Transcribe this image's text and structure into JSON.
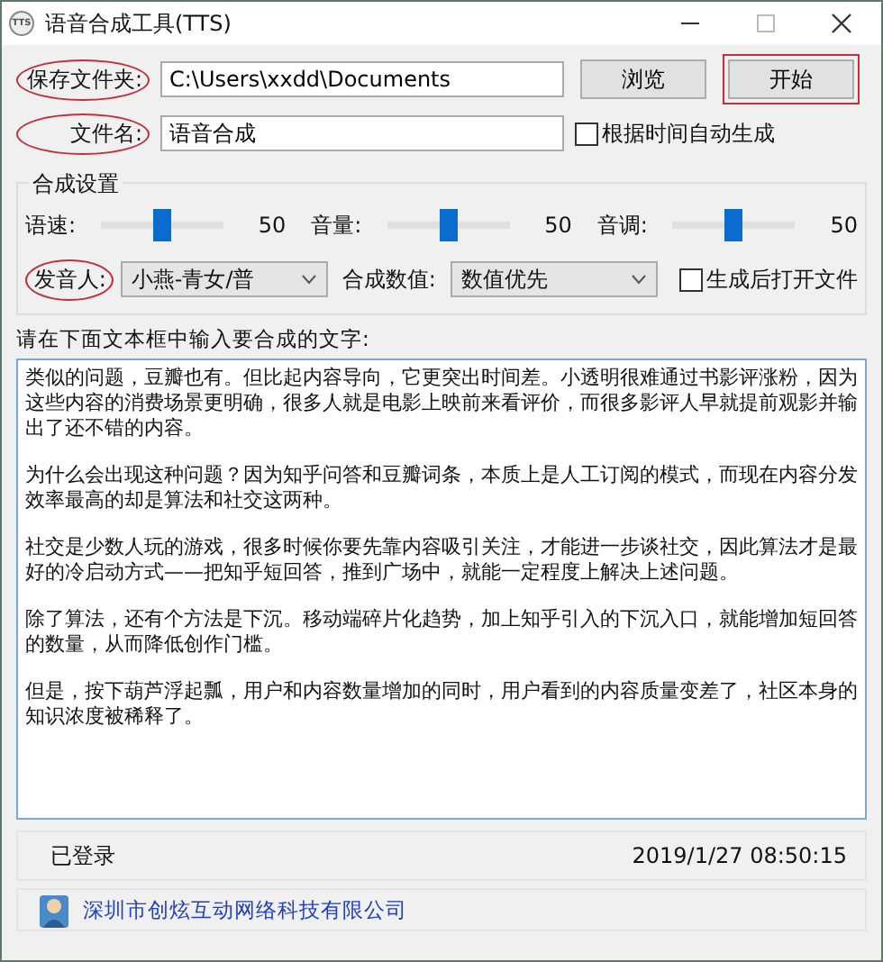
{
  "window": {
    "title": "语音合成工具(TTS)",
    "icon_text": "TTS"
  },
  "folder": {
    "label": "保存文件夹:",
    "circled": true,
    "value": "C:\\Users\\xxdd\\Documents"
  },
  "buttons": [
    {
      "label": "浏览",
      "boxed": false
    },
    {
      "label": "开始",
      "boxed": true
    }
  ],
  "filename": {
    "label": "文件名:",
    "circled": true,
    "value": "语音合成"
  },
  "auto_name": {
    "label": "根据时间自动生成",
    "checked": false
  },
  "settings": {
    "title": "合成设置",
    "sliders": [
      {
        "label": "语速:",
        "level": 0.5,
        "reading": "50"
      },
      {
        "label": "音量:",
        "level": 0.5,
        "reading": "50"
      },
      {
        "label": "音调:",
        "level": 0.5,
        "reading": "50"
      }
    ]
  },
  "voice": {
    "label": "发音人:",
    "circled": true,
    "value": "小燕-青女/普"
  },
  "mode": {
    "label": "合成数值:",
    "circled": false,
    "value": "数值优先"
  },
  "open_after": {
    "label": "生成后打开文件",
    "checked": false
  },
  "prompt": "请在下面文本框中输入要合成的文字:",
  "paragraphs": [
    "类似的问题，豆瓣也有。但比起内容导向，它更突出时间差。小透明很难通过书影评涨粉，因为这些内容的消费场景更明确，很多人就是电影上映前来看评价，而很多影评人早就提前观影并输出了还不错的内容。",
    "为什么会出现这种问题？因为知乎问答和豆瓣词条，本质上是人工订阅的模式，而现在内容分发效率最高的却是算法和社交这两种。",
    "社交是少数人玩的游戏，很多时候你要先靠内容吸引关注，才能进一步谈社交，因此算法才是最好的冷启动方式——把知乎短回答，推到广场中，就能一定程度上解决上述问题。",
    "除了算法，还有个方法是下沉。移动端碎片化趋势，加上知乎引入的下沉入口，就能增加短回答的数量，从而降低创作门槛。",
    "但是，按下葫芦浮起瓢，用户和内容数量增加的同时，用户看到的内容质量变差了，社区本身的知识浓度被稀释了。"
  ],
  "status_bar": {
    "status": "已登录",
    "time": "2019/1/27 08:50:15"
  },
  "footer": {
    "company": "深圳市创炫互动网络科技有限公司"
  }
}
